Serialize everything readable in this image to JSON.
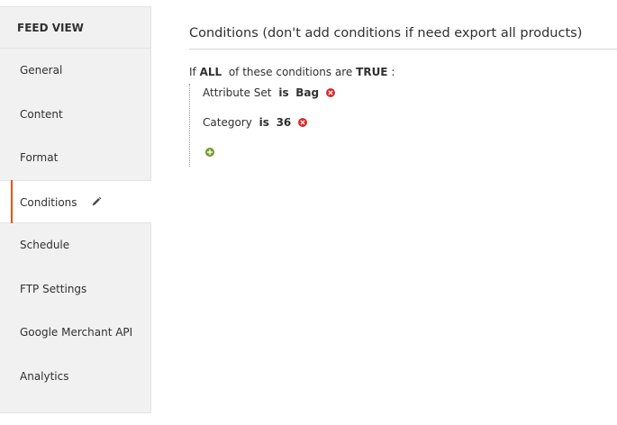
{
  "sidebar": {
    "header": "FEED VIEW",
    "items": [
      {
        "label": "General"
      },
      {
        "label": "Content"
      },
      {
        "label": "Format"
      },
      {
        "label": "Conditions"
      },
      {
        "label": "Schedule"
      },
      {
        "label": "FTP Settings"
      },
      {
        "label": "Google Merchant API"
      },
      {
        "label": "Analytics"
      }
    ],
    "active_index": 3
  },
  "main": {
    "title": "Conditions (don't add conditions if need export all products)",
    "rule": {
      "prefix": "If",
      "aggregator": "ALL",
      "middle": "of these conditions are",
      "value": "TRUE",
      "suffix": ":"
    },
    "conditions": [
      {
        "attribute": "Attribute Set",
        "operator": "is",
        "value": "Bag"
      },
      {
        "attribute": "Category",
        "operator": "is",
        "value": "36"
      }
    ]
  },
  "colors": {
    "accent": "#eb5202",
    "remove": "#e22626",
    "add": "#79a22e"
  },
  "icons": {
    "edit": "pencil-icon",
    "remove": "remove-icon",
    "add": "add-icon"
  }
}
